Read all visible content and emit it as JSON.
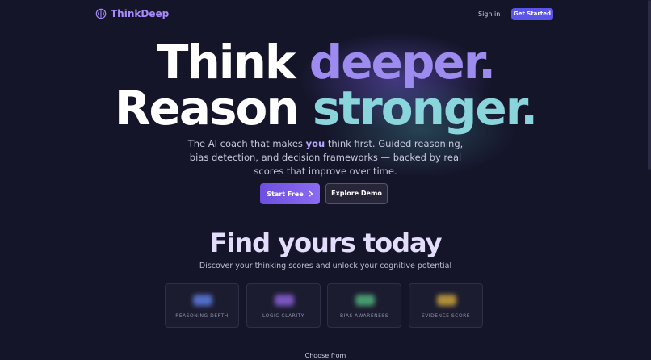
{
  "nav": {
    "brand": "ThinkDeep",
    "signin_label": "Sign in",
    "cta_label": "Get Started"
  },
  "hero": {
    "line1_a": "Think",
    "line1_b": "deeper.",
    "line2_a": "Reason",
    "line2_b": "stronger."
  },
  "subtitle": {
    "part1": "The AI coach that makes ",
    "emphasis": "you",
    "part2": " think first. Guided reasoning, bias detection, and decision frameworks — backed by real scores that improve over time."
  },
  "buttons": {
    "primary_label": "Start Free",
    "secondary_label": "Explore Demo"
  },
  "section": {
    "title": "Find yours today",
    "subtitle": "Discover your thinking scores and unlock your cognitive potential"
  },
  "score_cards": [
    {
      "label": "REASONING DEPTH",
      "color": "#5b7be0"
    },
    {
      "label": "LOGIC CLARITY",
      "color": "#8a5fd8"
    },
    {
      "label": "BIAS AWARENESS",
      "color": "#4fb07a"
    },
    {
      "label": "EVIDENCE SCORE",
      "color": "#c9a23c"
    }
  ],
  "footer_hint": "Choose from",
  "colors": {
    "background": "#15152a",
    "accent": "#5b54e8",
    "purple_text": "#9d8bf0",
    "teal_text": "#8ad4dc"
  },
  "icons": {
    "logo": "brain-icon",
    "primary_button": "chevron-right-icon"
  }
}
